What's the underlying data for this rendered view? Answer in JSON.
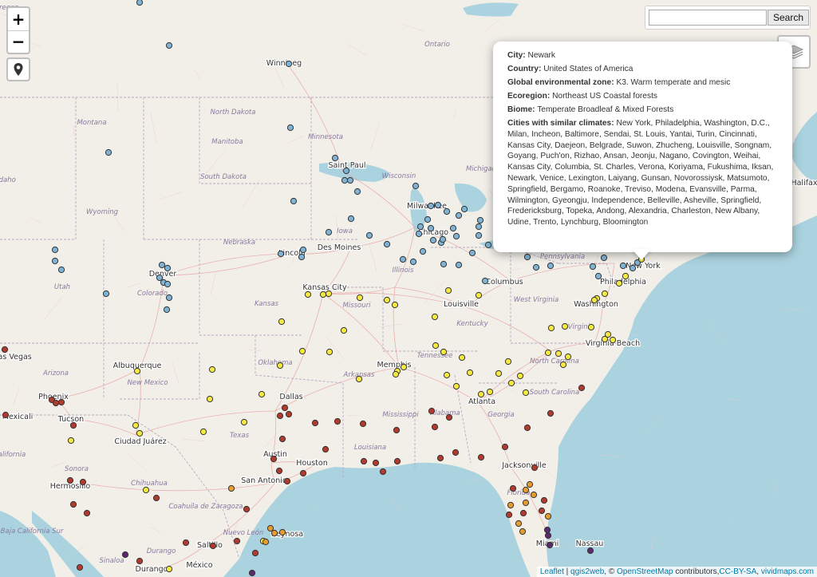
{
  "map_labels": {
    "provinces": [
      "Ontario",
      "Manitoba"
    ],
    "states": [
      "North Dakota",
      "Montana",
      "Minnesota",
      "Wisconsin",
      "Michigan",
      "South Dakota",
      "Wyoming",
      "Iowa",
      "Nebraska",
      "Colorado",
      "Kansas",
      "Missouri",
      "Illinois",
      "Kentucky",
      "West Virginia",
      "Pennsylvania",
      "Oklahoma",
      "Arkansas",
      "Tennessee",
      "North Carolina",
      "South Carolina",
      "Mississippi",
      "Alabama",
      "Georgia",
      "Louisiana",
      "Texas",
      "New Mexico",
      "Utah",
      "Arizona",
      "Virginia",
      "Florida",
      "Sonora",
      "Chihuahua",
      "Coahuila de Zaragoza",
      "Nuevo León",
      "Durango",
      "Baja California Sur",
      "Sinaloa",
      "California",
      "Idaho",
      "Oregon"
    ],
    "cities": [
      "Winnipeg",
      "Saint Paul",
      "Milwaukee",
      "Chicago",
      "Des Moines",
      "Lincoln",
      "Denver",
      "Kansas City",
      "Columbus",
      "Philadelphia",
      "New York",
      "Washington",
      "Louisville",
      "Virginia Beach",
      "Memphis",
      "Albuquerque",
      "Las Vegas",
      "Phoenix",
      "Mexicali",
      "Tucson",
      "Ciudad Juárez",
      "Dallas",
      "Atlanta",
      "Jacksonville",
      "Austin",
      "Houston",
      "San Antonio",
      "Hermosillo",
      "Saltillo",
      "Durango",
      "Miami",
      "Nassau",
      "Halifax",
      "México",
      "Reynosa"
    ]
  },
  "controls": {
    "zoom_in": "+",
    "zoom_out": "−",
    "locate_icon": "map-marker-icon",
    "layers_icon": "layers-icon",
    "search_placeholder": "",
    "search_value": "",
    "search_button": "Search"
  },
  "popup": {
    "city_label": "City:",
    "city": "Newark",
    "country_label": "Country:",
    "country": "United States of America",
    "zone_label": "Global environmental zone:",
    "zone": "K3. Warm temperate and mesic",
    "ecoregion_label": "Ecoregion:",
    "ecoregion": "Northeast US Coastal forests",
    "biome_label": "Biome:",
    "biome": "Temperate Broadleaf & Mixed Forests",
    "similar_label": "Cities with similar climates:",
    "similar": "New York, Philadelphia, Washington, D.C., Milan, Incheon, Baltimore, Sendai, St. Louis, Yantai, Turin, Cincinnati, Kansas City, Daejeon, Belgrade, Suwon, Zhucheng, Louisville, Songnam, Goyang, Puch'on, Rizhao, Ansan, Jeonju, Nagano, Covington, Weihai, Kansas City, Columbia, St. Charles, Verona, Koriyama, Fukushima, Iksan, Newark, Venice, Lexington, Laiyang, Gunsan, Novorossiysk, Matsumoto, Springfield, Bergamo, Roanoke, Treviso, Modena, Evansville, Parma, Wilmington, Gyeongju, Independence, Belleville, Asheville, Springfield, Fredericksburg, Topeka, Andong, Alexandria, Charleston, New Albany, Udine, Trento, Lynchburg, Bloomington"
  },
  "attribution": {
    "leaflet": "Leaflet",
    "sep1": " | ",
    "qgis": "qgis2web",
    "sep2": ", © ",
    "osm": "OpenStreetMap",
    "contrib": " contributors,",
    "license": "CC-BY-SA",
    "sep3": ", ",
    "vivid": "vividmaps.com"
  },
  "colors": {
    "land": "#f2efe9",
    "water": "#aad3df",
    "zone_blue": "#7fb3d5",
    "zone_yellow": "#f4e842",
    "zone_red": "#b03a2e",
    "zone_orange": "#e59b2e",
    "zone_purple": "#5b2a6e",
    "link": "#0078a8"
  }
}
